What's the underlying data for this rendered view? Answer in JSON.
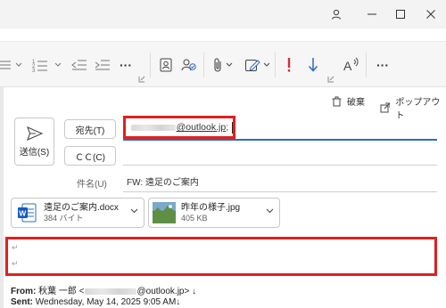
{
  "ribbon": {
    "more_label": "···"
  },
  "actions": {
    "discard_label": "破棄",
    "popout_label": "ポップアウト"
  },
  "compose": {
    "send_label": "送信(S)",
    "to_button": "宛先(T)",
    "cc_button": "ＣＣ(C)",
    "to_value_domain": "@outlook.jp",
    "to_value_suffix": "; ",
    "subject_label": "件名(U)",
    "subject_value": "FW: 遠足のご案内",
    "paragraph_mark": "↵"
  },
  "attachments": [
    {
      "name": "遠足のご案内.docx",
      "size": "384 バイト",
      "type": "word"
    },
    {
      "name": "昨年の様子.jpg",
      "size": "405 KB",
      "type": "image"
    }
  ],
  "quoted": {
    "from_label": "From:",
    "from_name": "秋葉 一郎 <",
    "from_domain": "@outlook.jp>",
    "from_mark": " ↓",
    "sent_label": "Sent:",
    "sent_value": " Wednesday, May 14, 2025 9:05 AM↓"
  },
  "colors": {
    "highlight": "#e0201e",
    "accent": "#2b6cc4",
    "priority_high": "#d13438",
    "priority_low": "#2b6cc4"
  }
}
